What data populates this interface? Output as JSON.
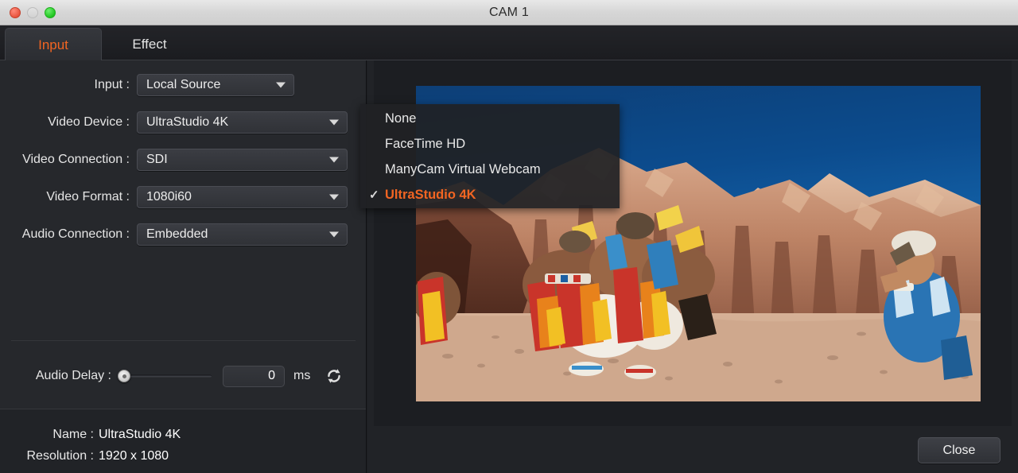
{
  "window": {
    "title": "CAM 1",
    "traffic_lights": [
      "close-light",
      "minimize-light",
      "zoom-light"
    ]
  },
  "tabs": [
    {
      "id": "input",
      "label": "Input",
      "active": true
    },
    {
      "id": "effect",
      "label": "Effect",
      "active": false
    }
  ],
  "form": {
    "rows": [
      {
        "label": "Input :",
        "value": "Local Source",
        "name": "input"
      },
      {
        "label": "Video Device :",
        "value": "UltraStudio 4K",
        "name": "video-device"
      },
      {
        "label": "Video Connection :",
        "value": "SDI",
        "name": "video-connection"
      },
      {
        "label": "Video Format :",
        "value": "1080i60",
        "name": "video-format"
      },
      {
        "label": "Audio Connection :",
        "value": "Embedded",
        "name": "audio-connection"
      }
    ]
  },
  "audio_delay": {
    "label": "Audio Delay :",
    "value": "0",
    "unit": "ms",
    "slider_position_percent": 0,
    "reset_icon": "refresh-icon"
  },
  "info": {
    "name_key": "Name :",
    "name_value": "UltraStudio 4K",
    "resolution_key": "Resolution :",
    "resolution_value": "1920 x 1080"
  },
  "dropdown": {
    "open": true,
    "check_glyph": "✓",
    "items": [
      {
        "label": "None",
        "selected": false
      },
      {
        "label": "FaceTime HD",
        "selected": false
      },
      {
        "label": "ManyCam Virtual Webcam",
        "selected": false
      },
      {
        "label": "UltraStudio 4K",
        "selected": true
      }
    ]
  },
  "footer": {
    "close_label": "Close"
  },
  "colors": {
    "accent": "#f26522",
    "panel_bg": "#26282c",
    "stage_bg": "#1c1e22",
    "titlebar": "#d6d6d6",
    "sky": "#0b3a6e",
    "rock": "#b8765a",
    "sand": "#d9b69c"
  },
  "preview": {
    "caption": "live-video-preview"
  }
}
